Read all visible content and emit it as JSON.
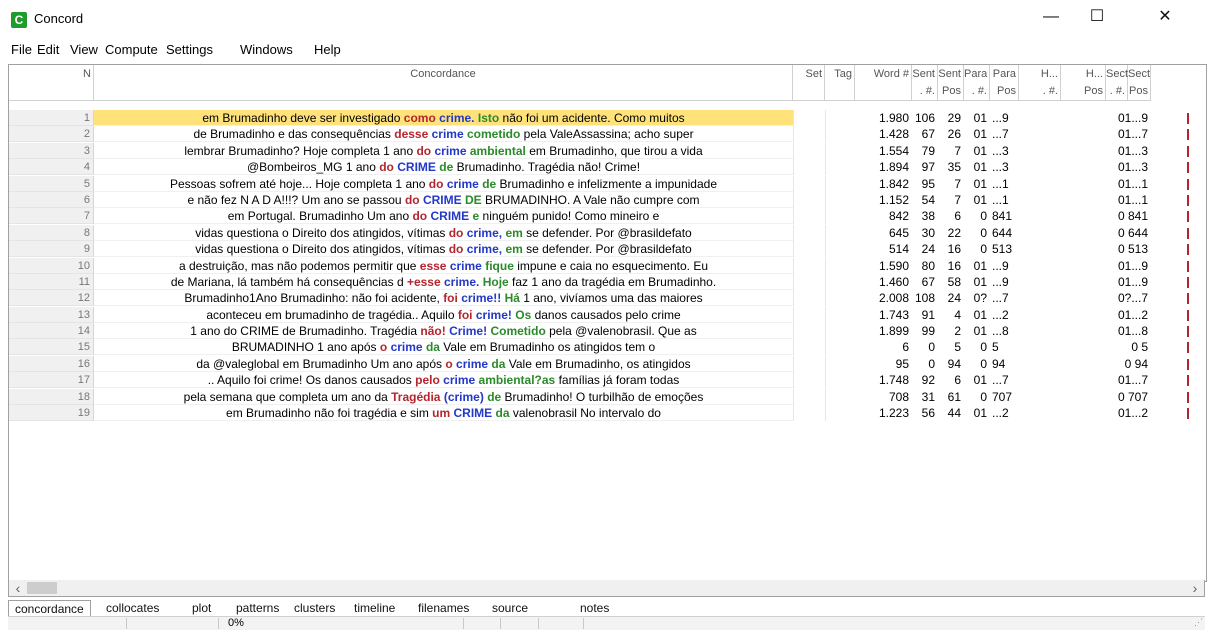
{
  "window": {
    "title": "Concord",
    "icon": "concord-app-icon",
    "icon_glyph": "C",
    "controls": {
      "minimize": "—",
      "maximize": "☐",
      "close": "✕"
    }
  },
  "menu": [
    "File",
    "Edit",
    "View",
    "Compute",
    "Settings",
    "Windows",
    "Help"
  ],
  "columns": {
    "n": "N",
    "concordance": "Concordance",
    "set": "Set",
    "tag": "Tag",
    "word": "Word #",
    "sent": "Sent",
    "sent2": ". #.",
    "sent_pos": "Sent",
    "sent_pos2": "Pos",
    "para": "Para",
    "para2": ". #.",
    "para_pos": "Para",
    "para_pos2": "Pos",
    "head": "H...",
    "head2": ". #.",
    "head_pos": "H...",
    "head_pos2": "Pos",
    "sect": "Sect",
    "sect2": ". #.",
    "sect_pos": "Sect",
    "sect_pos2": "Pos"
  },
  "rows": [
    {
      "n": "1",
      "left": "em Brumadinho deve ser investigado ",
      "k1": "como",
      "k1c": "red",
      "node": "crime.",
      "k2": "Isto",
      "k2c": "green",
      "right": " não foi um acidente. Como muitos",
      "word": "1.980",
      "sent": "106",
      "spos": "29",
      "para": "01",
      "ppos": "...9",
      "sec": "01...9",
      "sel": true
    },
    {
      "n": "2",
      "left": "de Brumadinho e das consequências ",
      "k1": "desse",
      "k1c": "red",
      "node": "crime",
      "k2": "cometido",
      "k2c": "green",
      "right": " pela ValeAssassina; acho super",
      "word": "1.428",
      "sent": "67",
      "spos": "26",
      "para": "01",
      "ppos": "...7",
      "sec": "01...7",
      "sel": false
    },
    {
      "n": "3",
      "left": "lembrar Brumadinho? Hoje completa 1 ano ",
      "k1": "do",
      "k1c": "red",
      "node": "crime",
      "k2": "ambiental",
      "k2c": "green",
      "right": " em Brumadinho, que tirou a vida",
      "word": "1.554",
      "sent": "79",
      "spos": "7",
      "para": "01",
      "ppos": "...3",
      "sec": "01...3",
      "sel": false
    },
    {
      "n": "4",
      "left": "@Bombeiros_MG 1 ano ",
      "k1": "do",
      "k1c": "red",
      "node": "CRIME",
      "k2": "de",
      "k2c": "green",
      "right": " Brumadinho. Tragédia não! Crime!",
      "word": "1.894",
      "sent": "97",
      "spos": "35",
      "para": "01",
      "ppos": "...3",
      "sec": "01...3",
      "sel": false
    },
    {
      "n": "5",
      "left": "Pessoas sofrem até hoje... Hoje completa 1 ano ",
      "k1": "do",
      "k1c": "red",
      "node": "crime",
      "k2": "de",
      "k2c": "green",
      "right": " Brumadinho e infelizmente a impunidade",
      "word": "1.842",
      "sent": "95",
      "spos": "7",
      "para": "01",
      "ppos": "...1",
      "sec": "01...1",
      "sel": false
    },
    {
      "n": "6",
      "left": "e não fez N A D A!!!? Um ano se passou ",
      "k1": "do",
      "k1c": "red",
      "node": "CRIME",
      "k2": "DE",
      "k2c": "green",
      "right": " BRUMADINHO. A Vale não cumpre com",
      "word": "1.152",
      "sent": "54",
      "spos": "7",
      "para": "01",
      "ppos": "...1",
      "sec": "01...1",
      "sel": false
    },
    {
      "n": "7",
      "left": "em Portugal. Brumadinho Um ano ",
      "k1": "do",
      "k1c": "red",
      "node": "CRIME",
      "k2": "e",
      "k2c": "green",
      "right": " ninguém punido! Como mineiro e",
      "word": "842",
      "sent": "38",
      "spos": "6",
      "para": "0",
      "ppos": "841",
      "sec": "0 841",
      "sel": false
    },
    {
      "n": "8",
      "left": "vidas questiona o Direito dos atingidos, vítimas ",
      "k1": "do",
      "k1c": "red",
      "node": "crime,",
      "k2": "em",
      "k2c": "green",
      "right": " se defender. Por @brasildefato",
      "word": "645",
      "sent": "30",
      "spos": "22",
      "para": "0",
      "ppos": "644",
      "sec": "0 644",
      "sel": false
    },
    {
      "n": "9",
      "left": "vidas questiona o Direito dos atingidos, vítimas ",
      "k1": "do",
      "k1c": "red",
      "node": "crime,",
      "k2": "em",
      "k2c": "green",
      "right": " se defender. Por @brasildefato",
      "word": "514",
      "sent": "24",
      "spos": "16",
      "para": "0",
      "ppos": "513",
      "sec": "0 513",
      "sel": false
    },
    {
      "n": "10",
      "left": "a destruição, mas não podemos permitir que ",
      "k1": "esse",
      "k1c": "red",
      "node": "crime",
      "k2": "fique",
      "k2c": "green",
      "right": " impune e caia no esquecimento. Eu",
      "word": "1.590",
      "sent": "80",
      "spos": "16",
      "para": "01",
      "ppos": "...9",
      "sec": "01...9",
      "sel": false
    },
    {
      "n": "11",
      "left": "de Mariana, lá também há consequências d ",
      "k1": "+esse",
      "k1c": "red",
      "node": "crime.",
      "k2": "Hoje",
      "k2c": "green",
      "right": " faz 1 ano da tragédia em Brumadinho.",
      "word": "1.460",
      "sent": "67",
      "spos": "58",
      "para": "01",
      "ppos": "...9",
      "sec": "01...9",
      "sel": false
    },
    {
      "n": "12",
      "left": "Brumadinho1Ano Brumadinho: não foi acidente, ",
      "k1": "foi",
      "k1c": "red",
      "node": "crime!!",
      "k2": "Há",
      "k2c": "green",
      "right": " 1 ano, vivíamos uma das maiores",
      "word": "2.008",
      "sent": "108",
      "spos": "24",
      "para": "0?",
      "ppos": "...7",
      "sec": "0?...7",
      "sel": false
    },
    {
      "n": "13",
      "left": "aconteceu em brumadinho de tragédia.. Aquilo ",
      "k1": "foi",
      "k1c": "red",
      "node": "crime!",
      "k2": "Os",
      "k2c": "green",
      "right": " danos causados pelo crime",
      "word": "1.743",
      "sent": "91",
      "spos": "4",
      "para": "01",
      "ppos": "...2",
      "sec": "01...2",
      "sel": false
    },
    {
      "n": "14",
      "left": "1 ano do CRIME de Brumadinho. Tragédia ",
      "k1": "não!",
      "k1c": "red",
      "node": "Crime!",
      "k2": "Cometido",
      "k2c": "green",
      "right": " pela @valenobrasil. Que as",
      "word": "1.899",
      "sent": "99",
      "spos": "2",
      "para": "01",
      "ppos": "...8",
      "sec": "01...8",
      "sel": false
    },
    {
      "n": "15",
      "left": "BRUMADINHO 1 ano após ",
      "k1": "o",
      "k1c": "red",
      "node": "crime",
      "k2": "da",
      "k2c": "green",
      "right": " Vale em Brumadinho os atingidos tem o",
      "word": "6",
      "sent": "0",
      "spos": "5",
      "para": "0",
      "ppos": "5",
      "sec": "0   5",
      "sel": false
    },
    {
      "n": "16",
      "left": "da @valeglobal em Brumadinho Um ano após ",
      "k1": "o",
      "k1c": "red",
      "node": "crime",
      "k2": "da",
      "k2c": "green",
      "right": " Vale em Brumadinho, os atingidos",
      "word": "95",
      "sent": "0",
      "spos": "94",
      "para": "0",
      "ppos": "94",
      "sec": "0  94",
      "sel": false
    },
    {
      "n": "17",
      "left": ".. Aquilo foi crime! Os danos causados ",
      "k1": "pelo",
      "k1c": "red",
      "node": "crime",
      "k2": "ambiental?as",
      "k2c": "green",
      "right": " famílias já foram todas",
      "word": "1.748",
      "sent": "92",
      "spos": "6",
      "para": "01",
      "ppos": "...7",
      "sec": "01...7",
      "sel": false
    },
    {
      "n": "18",
      "left": "pela semana que completa um ano da ",
      "k1": "Tragédia",
      "k1c": "red",
      "node": "(crime)",
      "k2": "de",
      "k2c": "green",
      "right": " Brumadinho! O turbilhão de emoções",
      "word": "708",
      "sent": "31",
      "spos": "61",
      "para": "0",
      "ppos": "707",
      "sec": "0 707",
      "sel": false
    },
    {
      "n": "19",
      "left": "em Brumadinho não foi tragédia e sim ",
      "k1": "um",
      "k1c": "red",
      "node": "CRIME",
      "k2": "da",
      "k2c": "green",
      "right": " valenobrasil No intervalo do",
      "word": "1.223",
      "sent": "56",
      "spos": "44",
      "para": "01",
      "ppos": "...2",
      "sec": "01...2",
      "sel": false
    }
  ],
  "scrollbar": {
    "left": "‹",
    "right": "›"
  },
  "tabs": [
    "concordance",
    "collocates",
    "plot",
    "patterns",
    "clusters",
    "timeline",
    "filenames",
    "source text",
    "notes"
  ],
  "active_tab": "concordance",
  "status": {
    "progress": "0%"
  },
  "colors": {
    "selected_row": "#ffe27a",
    "collocate_left": "#b3262e",
    "node_word": "#2238c8",
    "collocate_right": "#2b8a2b"
  }
}
